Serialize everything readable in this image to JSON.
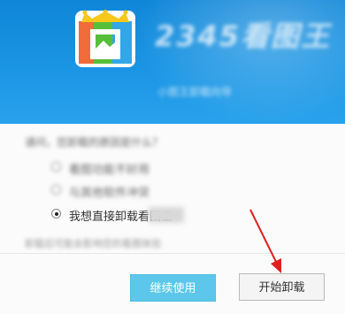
{
  "header": {
    "brand_text": "2345看图王",
    "tagline": "小图王卸载向导"
  },
  "form": {
    "question": "请问，您卸载的原因是什么？",
    "options": [
      {
        "label": "看图功能不好用",
        "selected": false
      },
      {
        "label": "与其他软件冲突",
        "selected": false
      },
      {
        "label": "我想直接卸载看图王",
        "selected": true
      }
    ],
    "note": "卸载后可能会影响您的看图体验"
  },
  "buttons": {
    "continue_label": "继续使用",
    "uninstall_label": "开始卸载"
  },
  "colors": {
    "header_blue": "#1a8fdf",
    "continue_button": "#5cc7ea",
    "annotation_arrow": "#e02020"
  },
  "icons": {
    "app_logo": "2345-picture-king-logo",
    "annotation": "red-arrow"
  }
}
